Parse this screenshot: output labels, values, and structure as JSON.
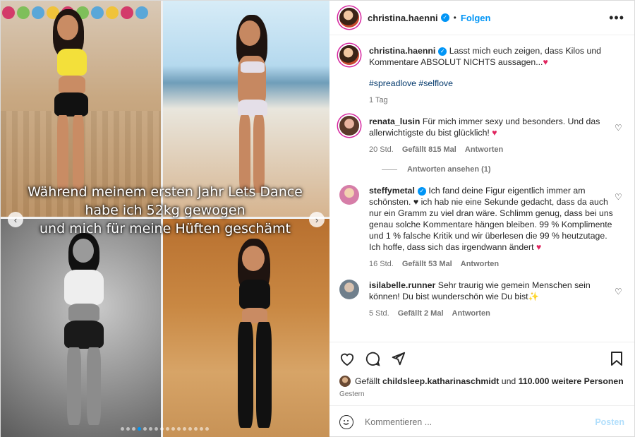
{
  "post": {
    "username": "christina.haenni",
    "follow_label": "Folgen",
    "separator": "•",
    "more_icon": "more-options-icon"
  },
  "media": {
    "caption_lines": [
      "Während meinem ersten Jahr Lets Dance",
      "habe ich 52kg gewogen",
      "und mich für meine Hüften geschämt"
    ],
    "dots_total": 16,
    "dots_active_index": 3
  },
  "caption": {
    "username": "christina.haenni",
    "text": "Lasst mich euch zeigen, dass Kilos und Kommentare ABSOLUT NICHTS aussagen...",
    "emoji": "♥",
    "hashtags": "#spreadlove #selflove",
    "time": "1 Tag"
  },
  "comments": [
    {
      "username": "renata_lusin",
      "verified": false,
      "text": "Für mich immer sexy und besonders. Und das allerwichtigste du bist glücklich!",
      "emoji": "♥",
      "time": "20 Std.",
      "likes": "Gefällt 815 Mal",
      "reply": "Antworten"
    },
    {
      "username": "steffymetal",
      "verified": true,
      "text": "Ich fand deine Figur eigentlich immer am schönsten. ♥ ich hab nie eine Sekunde gedacht, dass da auch nur ein Gramm zu viel dran wäre. Schlimm genug, dass bei uns genau solche Kommentare hängen bleiben. 99 % Komplimente und 1 % falsche Kritik und wir überlesen die 99 % heutzutage. Ich hoffe, dass sich das irgendwann ändert",
      "emoji": "♥",
      "time": "16 Std.",
      "likes": "Gefällt 53 Mal",
      "reply": "Antworten"
    },
    {
      "username": "isilabelle.runner",
      "verified": false,
      "text": "Sehr traurig wie gemein Menschen sein können! Du bist wunderschön wie Du bist",
      "emoji": "✨",
      "time": "5 Std.",
      "likes": "Gefällt 2 Mal",
      "reply": "Antworten"
    }
  ],
  "view_replies": "Antworten ansehen (1)",
  "likes_line": {
    "prefix": "Gefällt",
    "user": "childsleep.katharinaschmidt",
    "middle": "und",
    "count": "110.000 weitere Personen"
  },
  "date": "Gestern",
  "compose": {
    "placeholder": "Kommentieren ...",
    "post_label": "Posten"
  },
  "colors": {
    "accent": "#0095f6",
    "heart": "#e0245e",
    "hashtag": "#00376b"
  }
}
